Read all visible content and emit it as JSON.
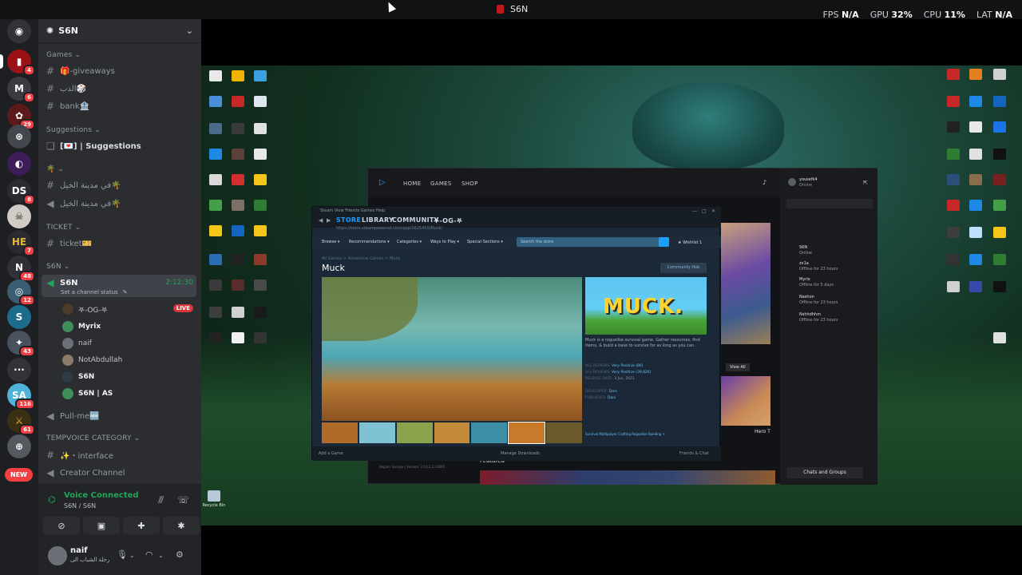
{
  "overlay": {
    "window_title": "S6N",
    "fps_label": "FPS",
    "fps_value": "N/A",
    "gpu_label": "GPU",
    "gpu_value": "32%",
    "cpu_label": "CPU",
    "cpu_value": "11%",
    "lat_label": "LAT",
    "lat_value": "N/A"
  },
  "server_rail": {
    "servers": [
      {
        "icon": "discord-home-icon",
        "badge": ""
      },
      {
        "icon": "server-red",
        "badge": "4"
      },
      {
        "icon": "server-m",
        "badge": "6"
      },
      {
        "icon": "server-red-flower",
        "badge": "29"
      },
      {
        "icon": "server-seal",
        "badge": ""
      },
      {
        "icon": "server-purple",
        "badge": ""
      },
      {
        "icon": "server-ds",
        "badge": "8"
      },
      {
        "icon": "server-skull",
        "badge": ""
      },
      {
        "icon": "server-he",
        "badge": "7"
      },
      {
        "icon": "server-n",
        "badge": "48"
      },
      {
        "icon": "server-globe",
        "badge": "12"
      },
      {
        "icon": "server-s",
        "badge": ""
      },
      {
        "icon": "server-anime",
        "badge": "43"
      },
      {
        "icon": "server-dots",
        "badge": ""
      },
      {
        "icon": "server-blue",
        "badge": "116"
      },
      {
        "icon": "server-gold",
        "badge": "61"
      },
      {
        "icon": "server-mono",
        "badge": ""
      }
    ],
    "new_label": "NEW"
  },
  "sidebar": {
    "guild_name": "S6N",
    "categories": {
      "games": "Games",
      "suggestions": "Suggestions",
      "ticket": "TICKET",
      "s6n": "S6N",
      "tempvoice": "TEMPVOICE CATEGORY"
    },
    "channels": {
      "giveaways": "🎁-giveaways",
      "game_ar": "الدب🎲",
      "bank": "bank🏦",
      "suggestions": "[💌] | Suggestions",
      "clover_cat": "🌴",
      "horses_text": "في مدينة الخيل🌴",
      "horses_voice": "في مدينة الخيل🌴",
      "ticket": "ticket🎫",
      "s6n_voice": "S6N",
      "pullme": "Pull-me🆕",
      "interface": "✨・interface",
      "creator": "Creator Channel"
    },
    "voice_status": "Set a channel status",
    "voice_timer": "2:12:30",
    "voice_users": [
      "𖤐-OG-𖤐",
      "Myrix",
      "naif",
      "NotAbdullah",
      "S6N",
      "S6N | AS"
    ],
    "live_label": "LIVE"
  },
  "voice_panel": {
    "title": "Voice Connected",
    "subtitle": "S6N / S6N"
  },
  "user_panel": {
    "name": "naif",
    "status": "رحلة الشباب الى"
  },
  "epic": {
    "nav": [
      "HOME",
      "GAMES",
      "SHOP"
    ],
    "username": "yousefk4",
    "user_status": "Online",
    "friends": [
      {
        "name": "S6N",
        "status": "Online"
      },
      {
        "name": "zx1a",
        "status": "Offline for 23 hours"
      },
      {
        "name": "Myrix",
        "status": "Offline for 5 days"
      },
      {
        "name": "Nashon",
        "status": "Offline for 23 hours"
      },
      {
        "name": "Nshhdhhm",
        "status": "Offline for 23 hours"
      }
    ],
    "chats_button": "Chats and Groups",
    "view_all": "View All",
    "hero_title": "Hero T",
    "featured": "Featured",
    "region": "Region: Europe | Version: 2.10.3.1.14065"
  },
  "steam": {
    "menu": "Steam  View  Friends  Games  Help",
    "nav": [
      "STORE",
      "LIBRARY",
      "COMMUNITY",
      "𖤐-OG-𖤐"
    ],
    "url": "https://store.steampowered.com/app/1625450/Muck/",
    "subnav": [
      "Browse ▾",
      "Recommendations ▾",
      "Categories ▾",
      "Ways to Play ▾",
      "Special Sections ▾"
    ],
    "search_placeholder": "Search the store",
    "wishlist": "★ Wishlist 1",
    "breadcrumb": "All Games > Adventure Games > Muck",
    "game_title": "Muck",
    "community_hub": "Community Hub",
    "capsule_title": "MUCK.",
    "description": "Muck is a roguelike survival game. Gather resources, find items, & build a base to survive for as long as you can.",
    "meta": {
      "recent_label": "ALL REVIEWS:",
      "recent_value": "Very Positive (86)",
      "all_label": "ALL REVIEWS:",
      "all_value": "Very Positive (39,826)",
      "release_label": "RELEASE DATE:",
      "release_value": "3 Jun, 2021",
      "dev_label": "DEVELOPER:",
      "dev_value": "Dani",
      "pub_label": "PUBLISHER:",
      "pub_value": "Dani"
    },
    "tags": "Survival  Multiplayer  Crafting  Roguelike  Building  +",
    "footer_add": "Add a Game",
    "footer_downloads": "Manage Downloads",
    "footer_friends": "Friends & Chat"
  },
  "desktop": {
    "recycle_bin": "Recycle Bin"
  }
}
